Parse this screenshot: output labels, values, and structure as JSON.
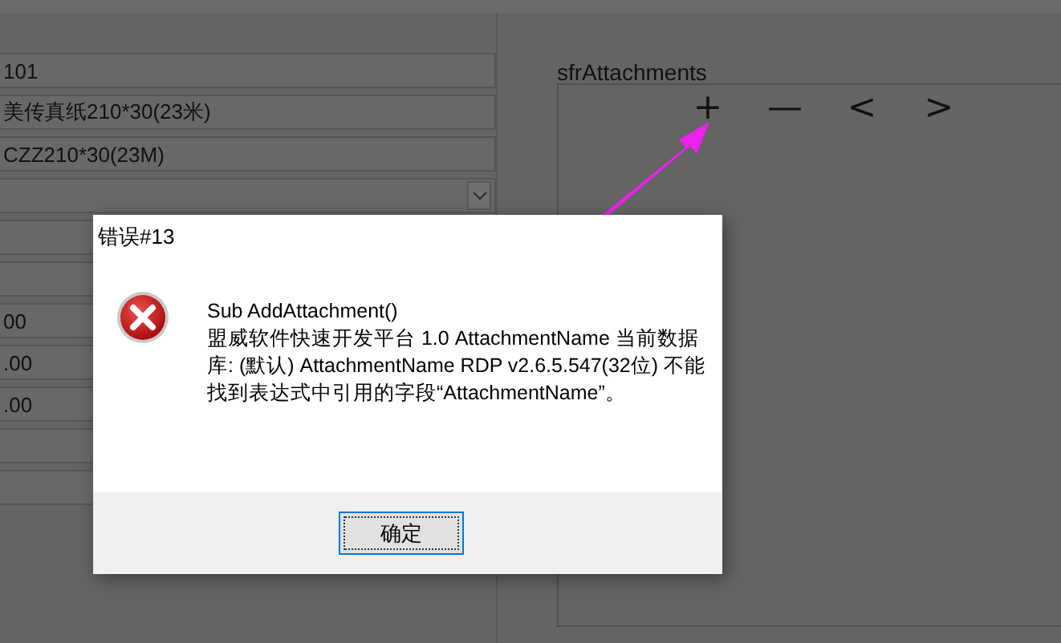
{
  "form": {
    "fields": [
      {
        "kind": "text",
        "value": "101"
      },
      {
        "kind": "text",
        "value": "美传真纸210*30(23米)"
      },
      {
        "kind": "text",
        "value": "CZZ210*30(23M)"
      },
      {
        "kind": "combo"
      },
      {
        "kind": "text"
      },
      {
        "kind": "text"
      },
      {
        "kind": "text",
        "value": "00"
      },
      {
        "kind": "text",
        "value": ".00"
      },
      {
        "kind": "text",
        "value": ".00"
      },
      {
        "kind": "text"
      },
      {
        "kind": "text"
      }
    ]
  },
  "subform": {
    "label": "sfrAttachments",
    "toolbar": [
      "+",
      "—",
      "<",
      ">"
    ]
  },
  "dialog": {
    "title": "错误#13",
    "kind": "error",
    "message_lines": [
      "Sub AddAttachment()",
      "盟威软件快速开发平台 1.0 AttachmentName 当前数据",
      "库: (默认) AttachmentName RDP v2.6.5.547(32位) 不能",
      "找到表达式中引用的字段“AttachmentName”。"
    ],
    "buttons": [
      "确定"
    ]
  }
}
